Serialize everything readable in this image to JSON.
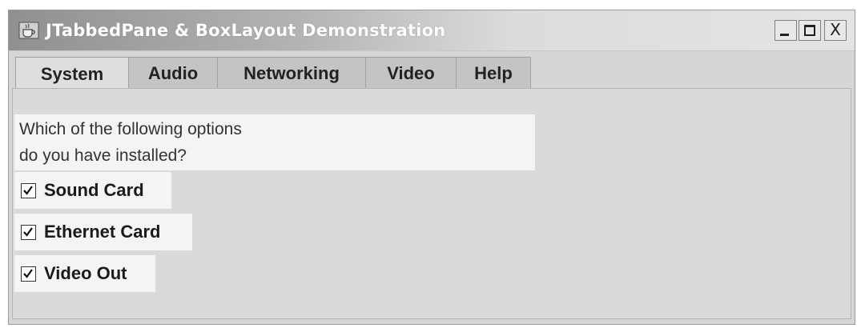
{
  "window": {
    "title": "JTabbedPane & BoxLayout Demonstration",
    "icon": "java-cup-icon",
    "controls": [
      "minimize-icon",
      "maximize-icon",
      "close-icon"
    ],
    "close_glyph": "X"
  },
  "tabs": [
    {
      "label": "System",
      "selected": true
    },
    {
      "label": "Audio",
      "selected": false
    },
    {
      "label": "Networking",
      "selected": false
    },
    {
      "label": "Video",
      "selected": false
    },
    {
      "label": "Help",
      "selected": false
    }
  ],
  "panel": {
    "question_line1": "Which of the following options",
    "question_line2": "do you have installed?",
    "options": [
      {
        "label": "Sound Card",
        "checked": true
      },
      {
        "label": "Ethernet Card",
        "checked": true
      },
      {
        "label": "Video Out",
        "checked": true
      }
    ]
  },
  "colors": {
    "title_text": "#ffffff",
    "panel_bg": "#dadada",
    "highlight_bg": "#f4f4f4"
  }
}
